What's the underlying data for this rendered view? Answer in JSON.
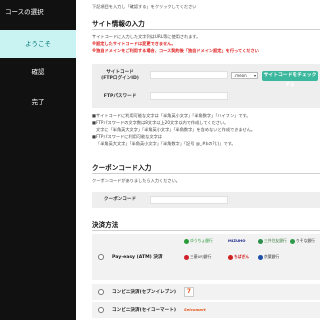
{
  "sidebar": {
    "items": [
      {
        "label": "コースの選択"
      },
      {
        "label": "ようこそ"
      },
      {
        "label": "確認"
      },
      {
        "label": "完了"
      }
    ]
  },
  "intro_note": "下記項目を入力し「確認する」をクリックしてください",
  "site_info": {
    "title": "サイト情報の入力",
    "notes": [
      "サイトコードに入力した文字列はURL等に使用されます。",
      "※設定したサイトコードは変更できません。",
      "※独自ドメインをご利用する場合、コース契約後「独自ドメイン設定」を行ってください"
    ],
    "site_code_label": "サイトコード\n(FTPログインID)",
    "domain_select": ".meon",
    "check_button": "サイトコードをチェックする",
    "ftp_password_label": "FTPパスワード",
    "rules": [
      "■サイトコードに利用可能な文字は「半角英小文字」「半角数字」「ハイフン」です。",
      "■FTPパスワードの文字数は8文字以上20文字以内で作成してください。",
      "文字に「半角英大文字」「半角英小文字」「半角数字」を含めないと作成できません。",
      "■FTPパスワードに利用可能な文字は",
      "「半角英大文字」「半角英小文字」「半角数字」「記号 @_#$の?(;)」です。"
    ]
  },
  "coupon": {
    "title": "クーポンコード入力",
    "note": "クーポンコードがありましたら入力ください。",
    "label": "クーポンコード"
  },
  "payment": {
    "title": "決済方法",
    "methods": [
      {
        "label": "Pay-easy (ATM) 決済",
        "logos": [
          "ゆうちょ銀行",
          "MIZUHO",
          "三井住友銀行",
          "りそな銀行",
          "三菱UFJ銀行",
          "ちばぎん",
          "京葉銀行"
        ]
      },
      {
        "label": "コンビニ決済(セブンイレブン)",
        "logos": [
          "7"
        ]
      },
      {
        "label": "コンビニ決済(セイコーマート)",
        "logos": [
          "Seicomart"
        ]
      }
    ]
  },
  "colors": {
    "sidebar_bg": "#111111",
    "active_bg": "#c9f3f3",
    "accent": "#3bb89d",
    "warning": "#e02020"
  }
}
